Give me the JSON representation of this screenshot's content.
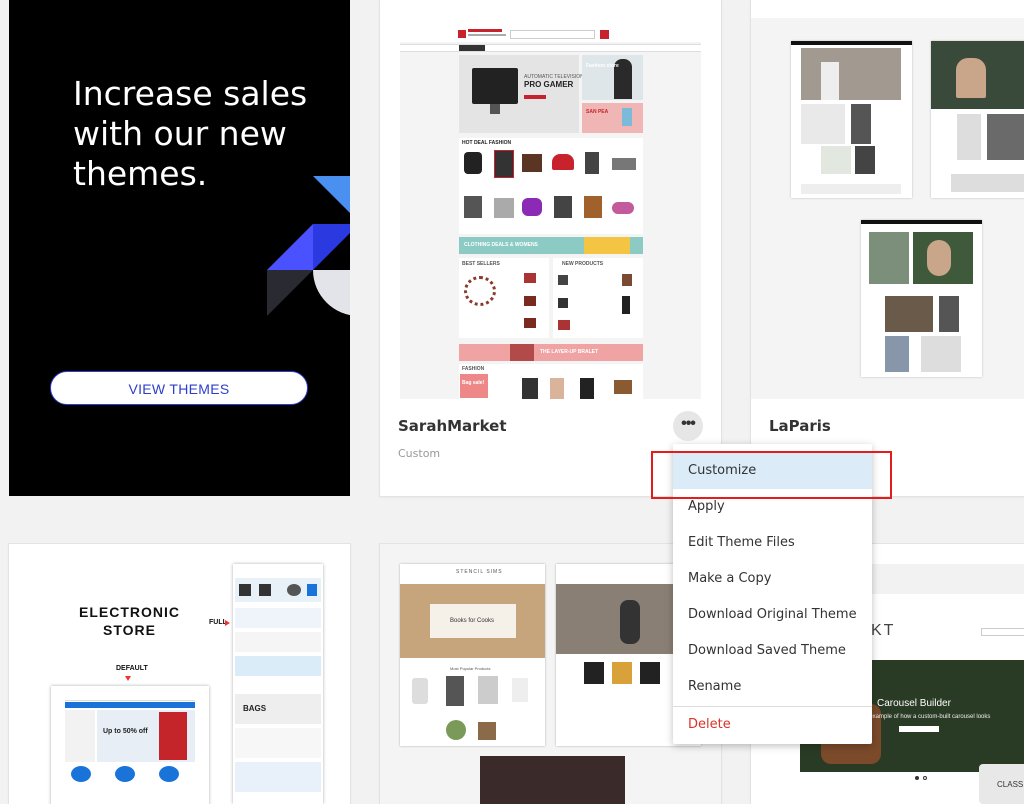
{
  "promo": {
    "heading": "Increase sales with our new themes.",
    "button_label": "VIEW THEMES",
    "accent": "#2c3ecc"
  },
  "themes": [
    {
      "name": "SarahMarket",
      "status": "Custom",
      "more_icon": "ellipsis-icon"
    },
    {
      "name": "LaParis",
      "status": ""
    }
  ],
  "previews": {
    "sarah": {
      "banner_pre": "AUTOMATIC TELEVISION",
      "banner_title": "PRO GAMER",
      "side_banner": "Fashion store",
      "sale_banner": "SAN PEA",
      "section_hot": "HOT DEAL FASHION",
      "promo_strip": "CLOTHING DEALS & WOMENS",
      "best_sellers": "BEST SELLERS",
      "new_products": "NEW PRODUCTS",
      "layer_strip": "THE LAYER-UP BRALET",
      "fashion_label": "FASHION",
      "bag_label": "Bag sale!"
    },
    "electronic": {
      "title_line1": "ELECTRONIC",
      "title_line2": "STORE",
      "full_label": "FULL",
      "default_label": "DEFAULT",
      "bags_label": "BAGS",
      "sale_text": "Up to 50% off"
    },
    "stencil": {
      "brand": "STENCIL SIMS",
      "banner_text": "Books for Cooks",
      "popular": "Most Popular Products"
    },
    "carousel": {
      "title": "Carousel Builder",
      "subtitle": "an example of how a custom-built carousel looks",
      "header_letters": "KT",
      "classic": "CLASSIC"
    }
  },
  "menu": {
    "items": [
      {
        "label": "Customize"
      },
      {
        "label": "Apply"
      },
      {
        "label": "Edit Theme Files"
      },
      {
        "label": "Make a Copy"
      },
      {
        "label": "Download Original Theme"
      },
      {
        "label": "Download Saved Theme"
      },
      {
        "label": "Rename"
      },
      {
        "label": "Delete"
      }
    ],
    "highlight_color": "#dcebf8",
    "danger_color": "#d9332a",
    "annotation_color": "#e41c1c"
  }
}
